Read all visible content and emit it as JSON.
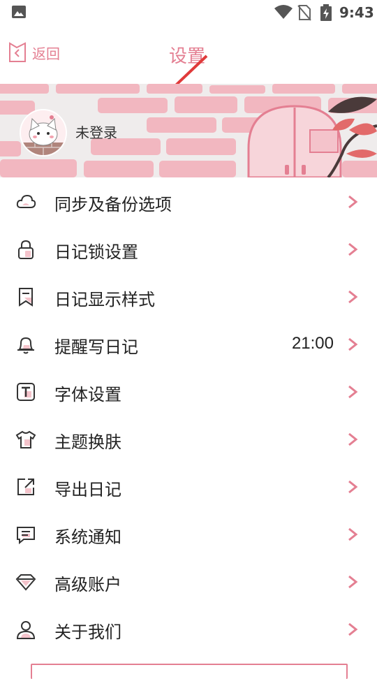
{
  "status_bar": {
    "time": "9:43"
  },
  "header": {
    "back_label": "返回",
    "title": "设置"
  },
  "banner": {
    "user_label": "未登录"
  },
  "menu": [
    {
      "label": "同步及备份选项",
      "icon": "cloud-icon"
    },
    {
      "label": "日记锁设置",
      "icon": "lock-icon"
    },
    {
      "label": "日记显示样式",
      "icon": "bookmark-icon"
    },
    {
      "label": "提醒写日记",
      "icon": "bell-icon",
      "value": "21:00"
    },
    {
      "label": "字体设置",
      "icon": "font-icon"
    },
    {
      "label": "主题换肤",
      "icon": "shirt-icon"
    },
    {
      "label": "导出日记",
      "icon": "export-icon"
    },
    {
      "label": "系统通知",
      "icon": "message-icon"
    },
    {
      "label": "高级账户",
      "icon": "diamond-icon"
    },
    {
      "label": "关于我们",
      "icon": "user-icon"
    }
  ],
  "colors": {
    "accent": "#e47f92",
    "fill": "#f4c3cb"
  }
}
